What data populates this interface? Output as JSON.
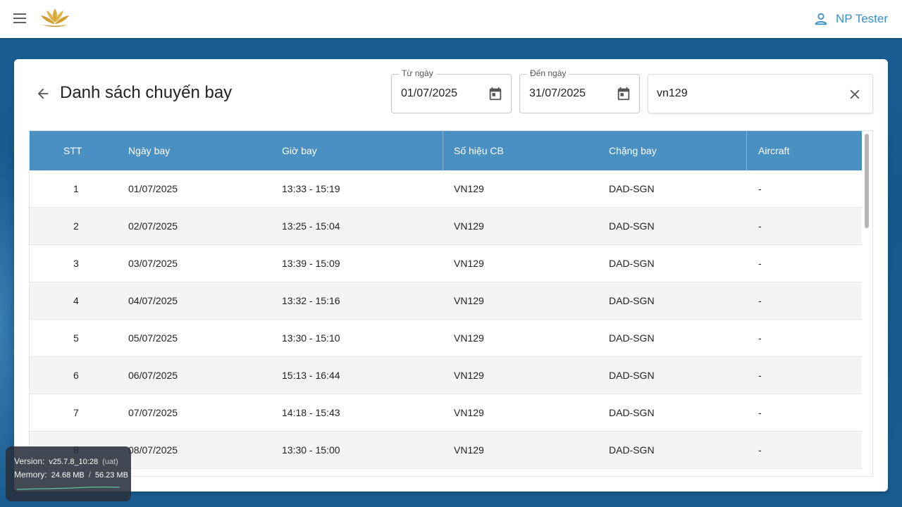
{
  "header": {
    "menu_icon": "hamburger-menu-icon",
    "logo_icon": "lotus-logo-icon",
    "user_icon": "user-icon",
    "user_name": "NP Tester",
    "brand_color": "#3a8fc7"
  },
  "page": {
    "title": "Danh sách chuyến bay",
    "back_icon": "arrow-back-icon"
  },
  "filters": {
    "from": {
      "label": "Từ ngày",
      "value": "01/07/2025"
    },
    "to": {
      "label": "Đến ngày",
      "value": "31/07/2025"
    },
    "search": {
      "value": "vn129"
    }
  },
  "table": {
    "columns": [
      "STT",
      "Ngày bay",
      "Giờ bay",
      "Số hiệu CB",
      "Chặng bay",
      "Aircraft"
    ],
    "header_color": "#4a90c2",
    "rows": [
      [
        "1",
        "01/07/2025",
        "13:33 - 15:19",
        "VN129",
        "DAD-SGN",
        "-"
      ],
      [
        "2",
        "02/07/2025",
        "13:25 - 15:04",
        "VN129",
        "DAD-SGN",
        "-"
      ],
      [
        "3",
        "03/07/2025",
        "13:39 - 15:09",
        "VN129",
        "DAD-SGN",
        "-"
      ],
      [
        "4",
        "04/07/2025",
        "13:32 - 15:16",
        "VN129",
        "DAD-SGN",
        "-"
      ],
      [
        "5",
        "05/07/2025",
        "13:30 - 15:10",
        "VN129",
        "DAD-SGN",
        "-"
      ],
      [
        "6",
        "06/07/2025",
        "15:13 - 16:44",
        "VN129",
        "DAD-SGN",
        "-"
      ],
      [
        "7",
        "07/07/2025",
        "14:18 - 15:43",
        "VN129",
        "DAD-SGN",
        "-"
      ],
      [
        "8",
        "08/07/2025",
        "13:30 - 15:00",
        "VN129",
        "DAD-SGN",
        "-"
      ]
    ]
  },
  "debug": {
    "version_label": "Version:",
    "version_value": "v25.7.8_10:28",
    "env": "(uat)",
    "memory_label": "Memory:",
    "memory_used": "24.68 MB",
    "memory_sep": "/",
    "memory_total": "56.23 MB"
  }
}
